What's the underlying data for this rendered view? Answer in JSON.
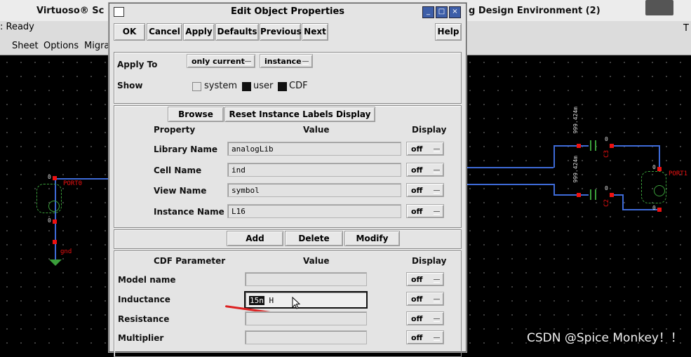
{
  "background": {
    "window_title_left": "Virtuoso® Sc",
    "window_title_right": "g Design Environment (2)",
    "status": ": Ready",
    "status_right": "T",
    "menu": [
      "Sheet",
      "Options",
      "Migra"
    ],
    "schematic": {
      "port0": "PORT0",
      "port1": "PORT1",
      "gnd": "gnd",
      "pin_zero": "0",
      "c2": "C2",
      "c3": "C3",
      "cap_value_1": "999.424m",
      "cap_value_2": "999.424m"
    },
    "watermark": "CSDN @Spice Monkey！！"
  },
  "dialog": {
    "title": "Edit Object Properties",
    "controls": [
      "_",
      "□",
      "×"
    ],
    "buttons": {
      "ok": "OK",
      "cancel": "Cancel",
      "apply": "Apply",
      "defaults": "Defaults",
      "previous": "Previous",
      "next": "Next",
      "help": "Help"
    },
    "apply_to": {
      "label": "Apply To",
      "scope": "only current",
      "target": "instance"
    },
    "show": {
      "label": "Show",
      "system": "system",
      "user": "user",
      "cdf": "CDF",
      "system_checked": false,
      "user_checked": true,
      "cdf_checked": true
    },
    "instance_section": {
      "browse": "Browse",
      "reset": "Reset Instance Labels Display",
      "headers": {
        "property": "Property",
        "value": "Value",
        "display": "Display"
      },
      "rows": [
        {
          "label": "Library Name",
          "value": "analogLib",
          "display": "off"
        },
        {
          "label": "Cell Name",
          "value": "ind",
          "display": "off"
        },
        {
          "label": "View Name",
          "value": "symbol",
          "display": "off"
        },
        {
          "label": "Instance Name",
          "value": "L16",
          "display": "off"
        }
      ],
      "add": "Add",
      "delete": "Delete",
      "modify": "Modify"
    },
    "cdf_section": {
      "headers": {
        "parameter": "CDF Parameter",
        "value": "Value",
        "display": "Display"
      },
      "rows": [
        {
          "label": "Model name",
          "value": "",
          "display": "off"
        },
        {
          "label": "Inductance",
          "value_selected": "15n",
          "value_rest": " H",
          "display": "off"
        },
        {
          "label": "Resistance",
          "value": "",
          "display": "off"
        },
        {
          "label": "Multiplier",
          "value": "",
          "display": "off"
        }
      ]
    }
  },
  "colors": {
    "wire": "#3e6bd8",
    "pin": "#e11111",
    "title_control": "#3d5ea8"
  }
}
